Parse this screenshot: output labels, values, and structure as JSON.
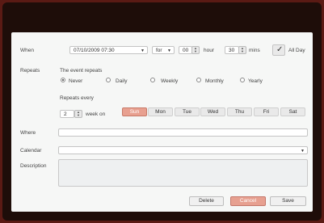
{
  "when": {
    "label": "When",
    "datetime": "07/10/2009 07:30",
    "for_label": "for",
    "hours_value": "00",
    "hour_label": "hour",
    "mins_value": "30",
    "mins_label": "mins",
    "allday_label": "All Day",
    "allday_checked": true
  },
  "repeats": {
    "label": "Repeats",
    "heading": "The event repeats",
    "options": [
      "Never",
      "Daily",
      "Weekly",
      "Monthly",
      "Yearly"
    ],
    "selected": "Never",
    "every_label": "Repeats every",
    "every_value": "2",
    "week_on_label": "week on",
    "days": [
      "Sun",
      "Mon",
      "Tue",
      "Wed",
      "Thu",
      "Fri",
      "Sat"
    ],
    "selected_day": "Sun"
  },
  "where": {
    "label": "Where",
    "value": ""
  },
  "calendar": {
    "label": "Calendar",
    "value": ""
  },
  "description": {
    "label": "Description",
    "value": ""
  },
  "buttons": {
    "delete": "Delete",
    "cancel": "Cancel",
    "save": "Save"
  }
}
